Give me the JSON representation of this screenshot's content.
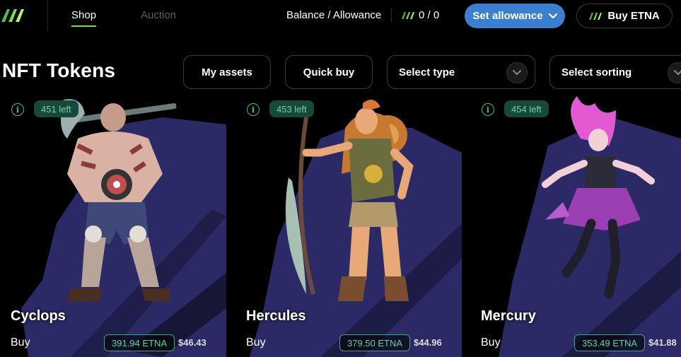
{
  "nav": {
    "tabs": [
      {
        "label": "Shop",
        "active": true
      },
      {
        "label": "Auction",
        "active": false
      }
    ],
    "balance_label": "Balance / Allowance",
    "balance_value": "0 / 0",
    "set_allowance_label": "Set allowance",
    "buy_etna_label": "Buy ETNA"
  },
  "page": {
    "title": "NFT Tokens",
    "my_assets_label": "My assets",
    "quick_buy_label": "Quick buy",
    "select_type_placeholder": "Select type",
    "select_sorting_placeholder": "Select sorting"
  },
  "cards": [
    {
      "name": "Cyclops",
      "left": "451 left",
      "buy_label": "Buy",
      "price_etna": "391.94 ETNA",
      "price_usd": "$46.43"
    },
    {
      "name": "Hercules",
      "left": "453 left",
      "buy_label": "Buy",
      "price_etna": "379.50 ETNA",
      "price_usd": "$44.96"
    },
    {
      "name": "Mercury",
      "left": "454 left",
      "buy_label": "Buy",
      "price_etna": "353.49 ETNA",
      "price_usd": "$41.88"
    }
  ],
  "colors": {
    "accent_green": "#7ddc4a",
    "primary_blue": "#3b7fd1",
    "badge_bg": "#16483b",
    "card_shadow": "#2b2966"
  },
  "icons": [
    "logo-icon",
    "chevron-down-icon",
    "info-icon",
    "etna-token-icon"
  ]
}
